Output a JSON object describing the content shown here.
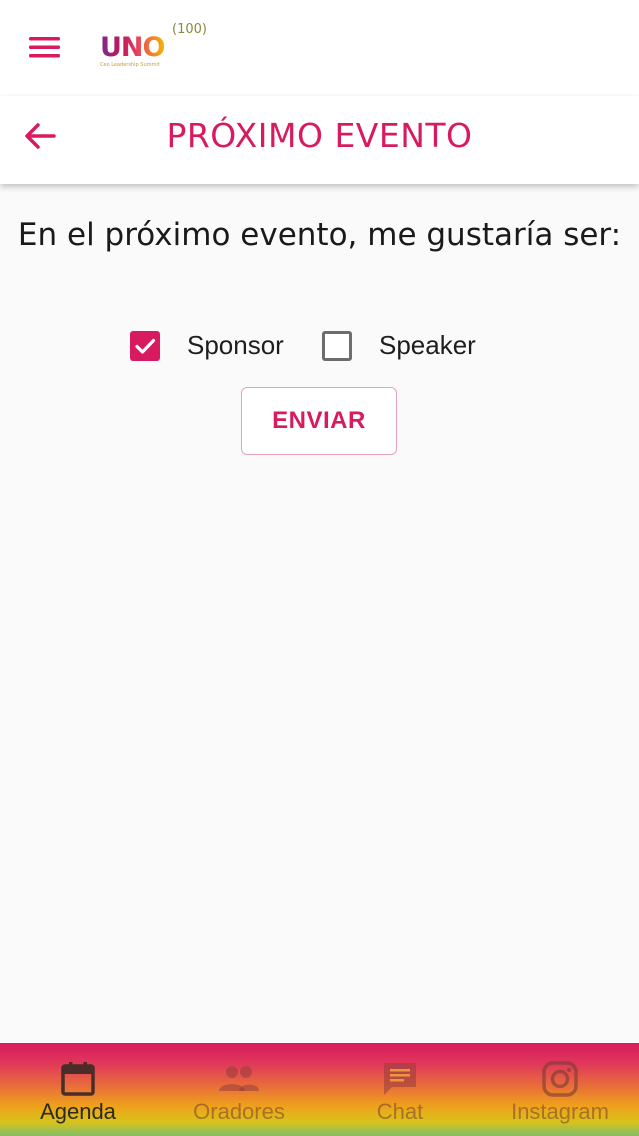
{
  "header": {
    "logo_text": "UNO",
    "logo_superscript": "(100)",
    "logo_tagline": "Ceo Leadership Summit"
  },
  "titlebar": {
    "title": "PRÓXIMO EVENTO"
  },
  "form": {
    "question": "En el próximo evento, me gustaría ser:",
    "options": [
      {
        "label": "Sponsor",
        "checked": true
      },
      {
        "label": "Speaker",
        "checked": false
      }
    ],
    "submit_label": "ENVIAR"
  },
  "bottom_nav": {
    "items": [
      {
        "label": "Agenda",
        "icon": "calendar-icon",
        "active": true
      },
      {
        "label": "Oradores",
        "icon": "people-icon",
        "active": false
      },
      {
        "label": "Chat",
        "icon": "chat-icon",
        "active": false
      },
      {
        "label": "Instagram",
        "icon": "instagram-icon",
        "active": false
      }
    ]
  },
  "colors": {
    "accent": "#d81b60",
    "background": "#fbfafb"
  }
}
